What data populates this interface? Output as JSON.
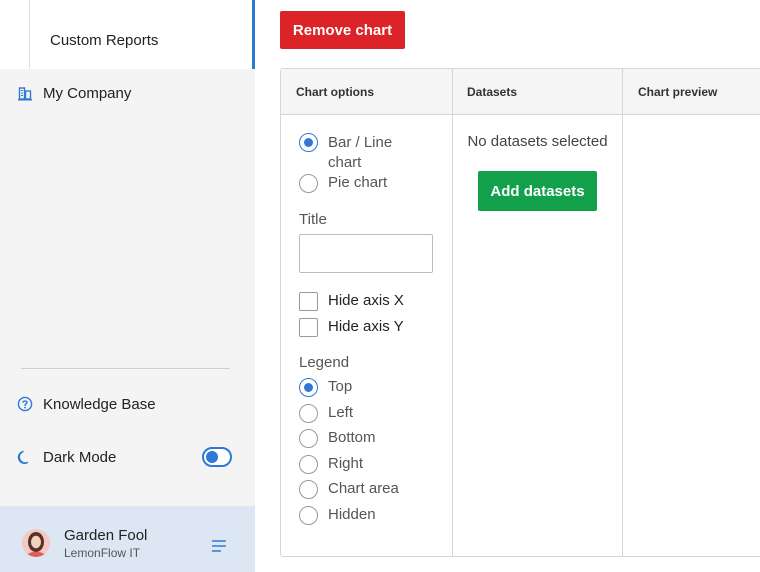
{
  "sidebar": {
    "sub_item": "Custom Reports",
    "company": "My Company",
    "knowledge_base": "Knowledge Base",
    "dark_mode": "Dark Mode",
    "dark_mode_on": true,
    "user": {
      "name": "Garden Fool",
      "org": "LemonFlow IT"
    },
    "icons": {
      "company": "building-icon",
      "kb": "help-circle-icon",
      "dark": "moon-icon",
      "menu": "menu-icon"
    }
  },
  "toolbar": {
    "remove_label": "Remove chart"
  },
  "panel": {
    "columns": [
      "Chart options",
      "Datasets",
      "Chart preview"
    ],
    "chart_type": {
      "options": [
        "Bar / Line chart",
        "Pie chart"
      ],
      "selected": "Bar / Line chart"
    },
    "title_label": "Title",
    "title_value": "",
    "hide_axis_x": "Hide axis X",
    "hide_axis_y": "Hide axis Y",
    "legend_label": "Legend",
    "legend": {
      "options": [
        "Top",
        "Left",
        "Bottom",
        "Right",
        "Chart area",
        "Hidden"
      ],
      "selected": "Top"
    },
    "datasets_empty": "No datasets selected",
    "add_datasets_label": "Add datasets"
  },
  "colors": {
    "accent": "#2e78d6",
    "danger": "#dc2328",
    "success": "#13a04a"
  }
}
